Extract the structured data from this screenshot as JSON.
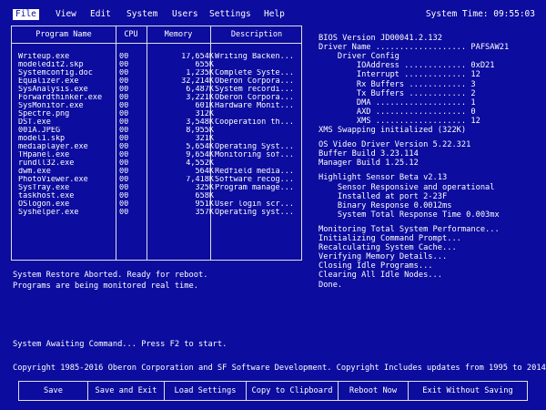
{
  "menu": {
    "items": [
      "File",
      "View",
      "Edit",
      "System",
      "Users",
      "Settings",
      "Help"
    ],
    "active": "File"
  },
  "system_time": "System Time: 09:55:03",
  "process_table": {
    "headers": [
      "Program Name",
      "CPU",
      "Memory",
      "Description"
    ],
    "rows": [
      [
        "Writeup.exe",
        "00",
        "17,654K",
        "Writing Backen..."
      ],
      [
        "modeledit2.skp",
        "00",
        "655K",
        ""
      ],
      [
        "Systemconfig.doc",
        "00",
        "1,235K",
        "Complete Syste..."
      ],
      [
        "Equalizer.exe",
        "00",
        "32,214K",
        "Oberon Corpora..."
      ],
      [
        "SysAnalysis.exe",
        "00",
        "6,487K",
        "System recordi..."
      ],
      [
        "Forwardthinker.exe",
        "00",
        "3,221K",
        "Oberon Corpora..."
      ],
      [
        "SysMonitor.exe",
        "00",
        "601K",
        "Hardware Monit..."
      ],
      [
        "Spectre.png",
        "00",
        "312K",
        ""
      ],
      [
        "DST.exe",
        "00",
        "3,548K",
        "Cooperation th..."
      ],
      [
        "001A.JPEG",
        "00",
        "8,955K",
        ""
      ],
      [
        "model1.skp",
        "00",
        "321K",
        ""
      ],
      [
        "mediaplayer.exe",
        "00",
        "5,654K",
        "Operating Syst..."
      ],
      [
        "THpanel.exe",
        "00",
        "9,654K",
        "Monitoring sof..."
      ],
      [
        "rundll32.exe",
        "00",
        "4,552K",
        ""
      ],
      [
        "dwm.exe",
        "00",
        "564K",
        "Redfield media..."
      ],
      [
        "PhotoViewer.exe",
        "00",
        "7,418K",
        "Software recog..."
      ],
      [
        "SysTray.exe",
        "00",
        "325K",
        "Program manage..."
      ],
      [
        "taskhost.exe",
        "00",
        "658K",
        ""
      ],
      [
        "OSlogon.exe",
        "00",
        "951K",
        "User login scr..."
      ],
      [
        "Syshelper.exe",
        "00",
        "357K",
        "Operating syst..."
      ]
    ]
  },
  "messages": {
    "restore": "System Restore Aborted. Ready for reboot.",
    "monitoring": "Programs are being monitored real time.",
    "awaiting": "System Awaiting Command... Press F2 to start.",
    "copyright": "Copyright 1985-2016 Oberon Corporation and SF Software Development. Copyright Includes updates from 1995 to 2014."
  },
  "right_panel": {
    "lines": [
      "BIOS Version JD00041.2.132",
      "Driver Name ................... PAFSAW21",
      "    Driver Config",
      "        IOAddress ............. 0xD21",
      "        Interrupt ............. 12",
      "        Rx Buffers ............ 3",
      "        Tx Buffers ............ 2",
      "        DMA ................... 1",
      "        AXD ................... 0",
      "        XMS ................... 12",
      "XMS Swapping initialized (322K)",
      "",
      "OS Video Driver Version 5.22.321",
      "Buffer Build 3.23.114",
      "Manager Build 1.25.12",
      "",
      "Highlight Sensor Beta v2.13",
      "    Sensor Responsive and operational",
      "    Installed at port 2-23F",
      "    Binary Response 0.0012ms",
      "    System Total Response Time 0.003mx",
      "",
      "Monitoring Total System Performance...",
      "Initializing Command Prompt...",
      "Recalculating System Cache...",
      "Verifying Memory Details...",
      "Closing Idle Programs...",
      "Clearing All Idle Nodes...",
      "Done."
    ]
  },
  "function_keys": [
    "Save",
    "Save and Exit",
    "Load Settings",
    "Copy to Clipboard",
    "Reboot Now",
    "Exit Without Saving"
  ],
  "colors": {
    "background": "#0c0c9e",
    "foreground": "#ffffff",
    "border": "#e0e0e0"
  }
}
